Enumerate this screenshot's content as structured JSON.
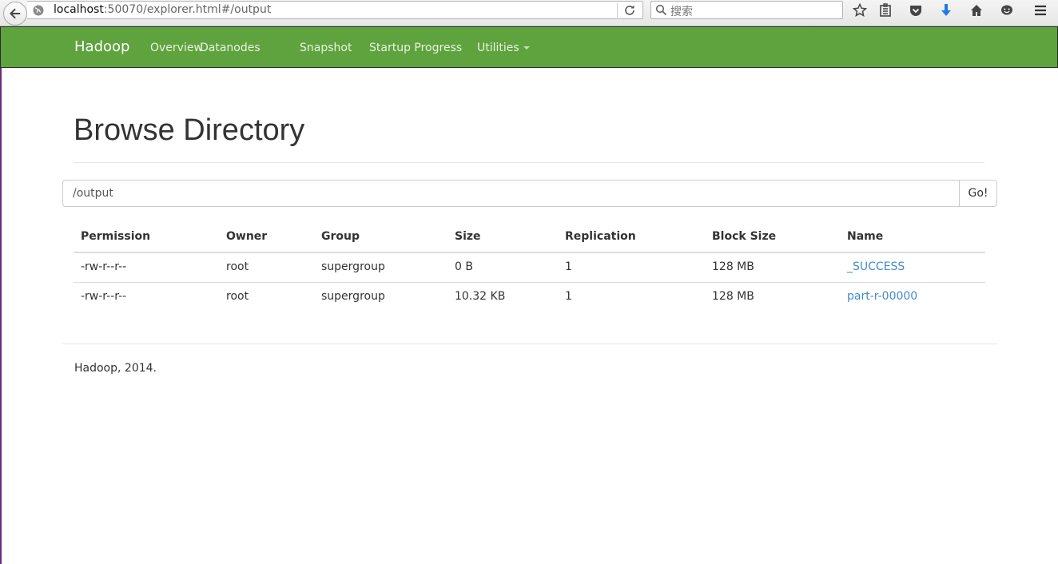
{
  "browser": {
    "url_host": "localhost",
    "url_rest": ":50070/explorer.html#/output",
    "search_placeholder": "搜索"
  },
  "navbar": {
    "brand": "Hadoop",
    "items": [
      "Overview",
      "Datanodes",
      "Snapshot",
      "Startup Progress",
      "Utilities"
    ],
    "bg_color": "#5fa33e"
  },
  "page": {
    "title": "Browse Directory",
    "path_value": "/output",
    "go_label": "Go!",
    "footer": "Hadoop, 2014."
  },
  "table": {
    "headers": [
      "Permission",
      "Owner",
      "Group",
      "Size",
      "Replication",
      "Block Size",
      "Name"
    ],
    "rows": [
      [
        "-rw-r--r--",
        "root",
        "supergroup",
        "0 B",
        "1",
        "128 MB",
        "_SUCCESS"
      ],
      [
        "-rw-r--r--",
        "root",
        "supergroup",
        "10.32 KB",
        "1",
        "128 MB",
        "part-r-00000"
      ]
    ]
  },
  "colors": {
    "link": "#428bca"
  }
}
